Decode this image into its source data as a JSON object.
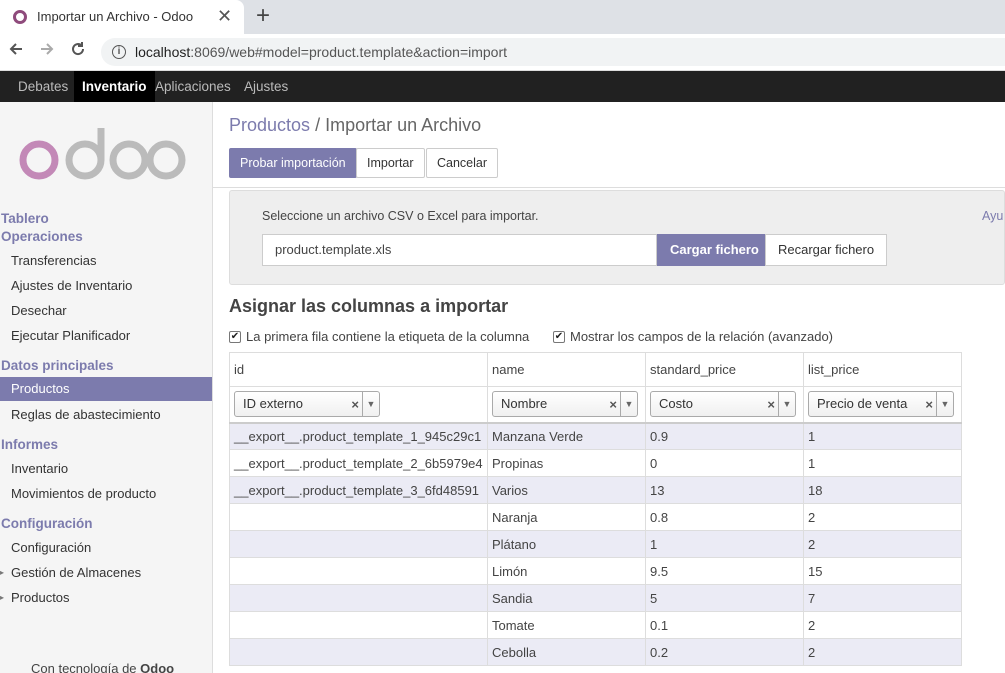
{
  "browser": {
    "tab_title": "Importar un Archivo - Odoo",
    "tab_close": "✕",
    "new_tab": "+",
    "url_host": "localhost",
    "url_rest": ":8069/web#model=product.template&action=import"
  },
  "topmenu": {
    "items": [
      "Debates",
      "Inventario",
      "Aplicaciones",
      "Ajustes"
    ],
    "active": "Inventario"
  },
  "sidebar": {
    "sections": [
      {
        "label": "Tablero"
      },
      {
        "label": "Operaciones",
        "items": [
          "Transferencias",
          "Ajustes de Inventario",
          "Desechar",
          "Ejecutar Planificador"
        ]
      },
      {
        "label": "Datos principales",
        "items": [
          "Productos",
          "Reglas de abastecimiento"
        ]
      },
      {
        "label": "Informes",
        "items": [
          "Inventario",
          "Movimientos de producto"
        ]
      },
      {
        "label": "Configuración",
        "items": [
          "Configuración",
          "Gestión de Almacenes",
          "Productos"
        ]
      }
    ],
    "active_item": "Productos",
    "footer_prefix": "Con tecnología de",
    "footer_brand": "Odoo"
  },
  "breadcrumb": {
    "parent": "Productos",
    "separator": "/",
    "current": "Importar un Archivo"
  },
  "buttons": {
    "test": "Probar importación",
    "import": "Importar",
    "cancel": "Cancelar"
  },
  "import_box": {
    "instruction": "Seleccione un archivo CSV o Excel para importar.",
    "help": "Ayu",
    "file_name": "product.template.xls",
    "load_button": "Cargar fichero",
    "reload_button": "Recargar fichero"
  },
  "mapping": {
    "title": "Asignar las columnas a importar",
    "checkbox_header": "La primera fila contiene la etiqueta de la columna",
    "checkbox_relations": "Mostrar los campos de la relación (avanzado)",
    "columns": [
      "id",
      "name",
      "standard_price",
      "list_price"
    ],
    "field_selects": [
      "ID externo",
      "Nombre",
      "Costo",
      "Precio de venta"
    ],
    "rows": [
      [
        "__export__.product_template_1_945c29c1",
        "Manzana Verde",
        "0.9",
        "1"
      ],
      [
        "__export__.product_template_2_6b5979e4",
        "Propinas",
        "0",
        "1"
      ],
      [
        "__export__.product_template_3_6fd48591",
        "Varios",
        "13",
        "18"
      ],
      [
        "",
        "Naranja",
        "0.8",
        "2"
      ],
      [
        "",
        "Plátano",
        "1",
        "2"
      ],
      [
        "",
        "Limón",
        "9.5",
        "15"
      ],
      [
        "",
        "Sandia",
        "5",
        "7"
      ],
      [
        "",
        "Tomate",
        "0.1",
        "2"
      ],
      [
        "",
        "Cebolla",
        "0.2",
        "2"
      ]
    ]
  },
  "colors": {
    "accent": "#7c7bad",
    "topbar": "#212121"
  }
}
